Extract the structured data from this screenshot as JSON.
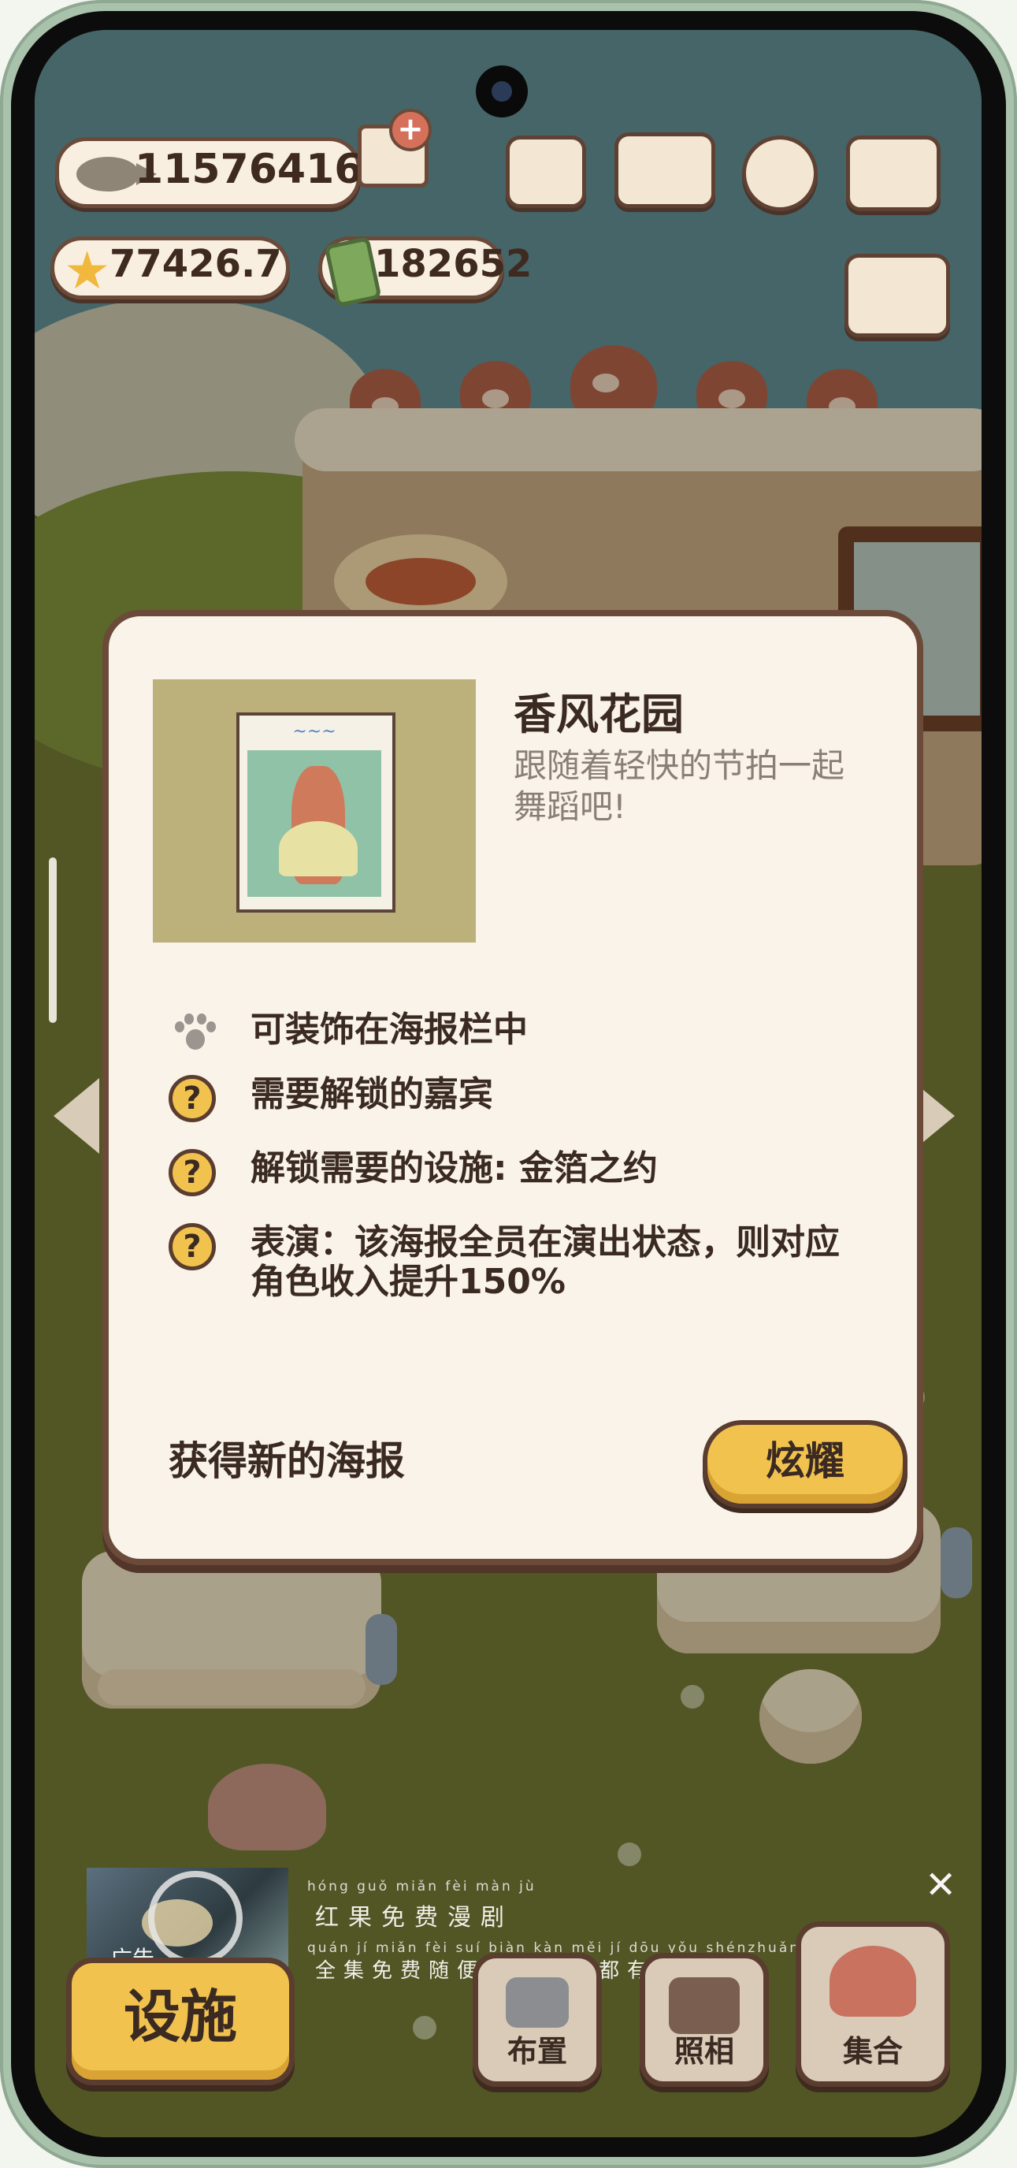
{
  "hud": {
    "fish_count": "11576416",
    "star_value": "77426.7",
    "battery_value": "182652"
  },
  "dialog": {
    "title": "香风花园",
    "subtitle": "跟随着轻快的节拍一起舞蹈吧!",
    "features": [
      {
        "icon": "paw-icon",
        "text": "可装饰在海报栏中"
      },
      {
        "icon": "question-icon",
        "text": "需要解锁的嘉宾"
      },
      {
        "icon": "question-icon",
        "text": "解锁需要的设施: 金箔之约"
      },
      {
        "icon": "question-icon",
        "text": "表演：该海报全员在演出状态，则对应角色收入提升150%"
      }
    ],
    "question_mark": "?",
    "footer_text": "获得新的海报",
    "flaunt_label": "炫耀"
  },
  "ad": {
    "badge": "广告",
    "line1_pinyin": "hóng guǒ miǎn fèi màn jù",
    "line1": "红果免费漫剧",
    "line2_pinyin": "quán jí miǎn fèi suí biàn kàn   měi jí dōu yǒu shénzhuǎn zhé",
    "line2": "全集免费随便看，每集都有神转折",
    "close": "✕"
  },
  "bottom": {
    "facilities_label": "设施",
    "layout_label": "布置",
    "photo_label": "照相",
    "gather_label": "集合"
  },
  "colors": {
    "accent_yellow": "#f2c24f",
    "outline_brown": "#5a3d2f",
    "dialog_bg": "#f9f3ea"
  }
}
